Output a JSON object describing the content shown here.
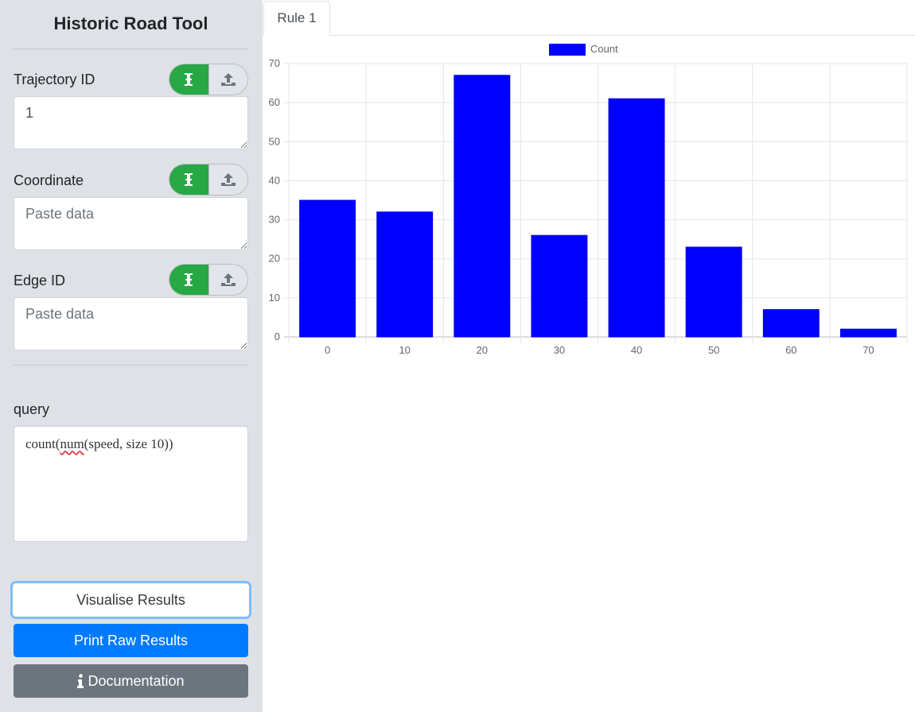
{
  "sidebar": {
    "title": "Historic Road Tool",
    "fields": [
      {
        "label": "Trajectory ID",
        "value": "1",
        "placeholder": "Paste data"
      },
      {
        "label": "Coordinate",
        "value": "",
        "placeholder": "Paste data"
      },
      {
        "label": "Edge ID",
        "value": "",
        "placeholder": "Paste data"
      }
    ],
    "query": {
      "label": "query",
      "text_before": "count(",
      "text_misspelled": "num",
      "text_after": "(speed, size 10))"
    },
    "buttons": {
      "visualise": "Visualise Results",
      "print": "Print Raw Results",
      "documentation": "Documentation"
    }
  },
  "tabs": [
    {
      "label": "Rule 1"
    }
  ],
  "colors": {
    "sidebar_bg": "#dee2e6",
    "toggle_active": "#28a745",
    "primary": "#007bff",
    "secondary": "#6c757d",
    "bar": "#0000ff"
  },
  "icons": {
    "text_input": "text-cursor-icon",
    "upload": "upload-icon",
    "info": "info-icon"
  },
  "chart_data": {
    "type": "bar",
    "categories": [
      "0",
      "10",
      "20",
      "30",
      "40",
      "50",
      "60",
      "70"
    ],
    "series": [
      {
        "name": "Count",
        "values": [
          35,
          32,
          67,
          26,
          61,
          23,
          7,
          2
        ]
      }
    ],
    "ylim": [
      0,
      70
    ],
    "yticks": [
      0,
      10,
      20,
      30,
      40,
      50,
      60,
      70
    ],
    "grid": true,
    "legend": "top"
  }
}
